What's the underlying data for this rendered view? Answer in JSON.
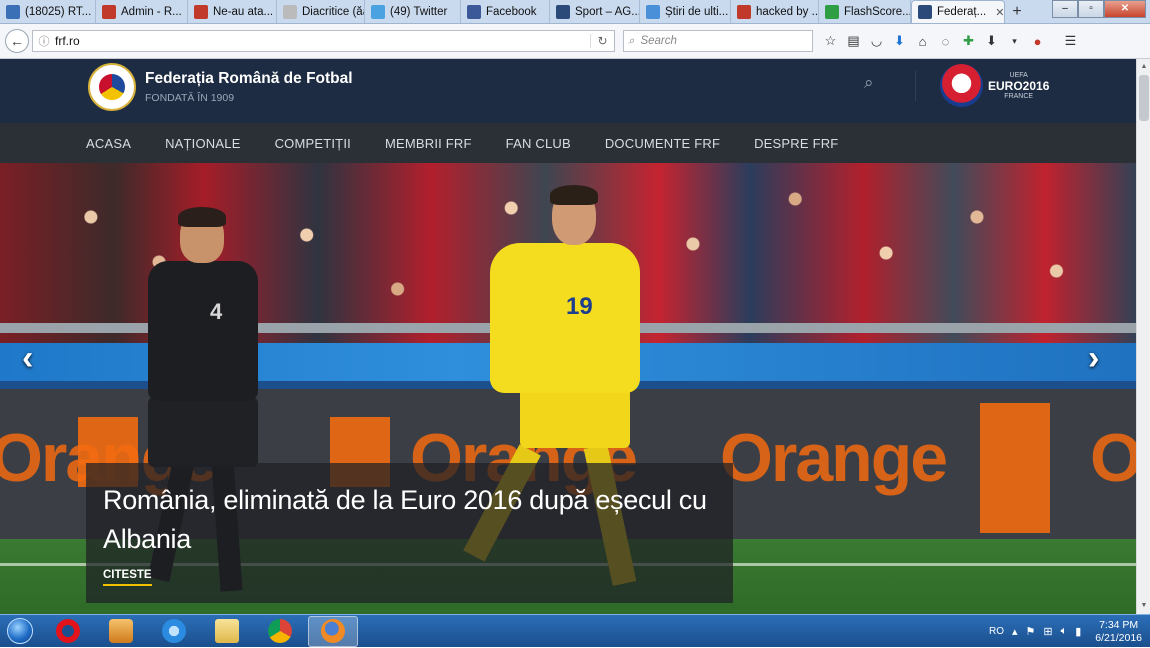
{
  "browser": {
    "tabs": [
      {
        "label": "(18025) RT...",
        "icon": "chat-icon",
        "color": "#3b6fb6"
      },
      {
        "label": "Admin - R...",
        "icon": "r-logo-icon",
        "color": "#c0392b"
      },
      {
        "label": "Ne-au ata...",
        "icon": "g-logo-icon",
        "color": "#c0392b"
      },
      {
        "label": "Diacritice (ăâîș...",
        "icon": "page-icon",
        "color": "#bbbbbb"
      },
      {
        "label": "(49) Twitter",
        "icon": "twitter-icon",
        "color": "#4aa3e0"
      },
      {
        "label": "Facebook",
        "icon": "facebook-icon",
        "color": "#3b5998"
      },
      {
        "label": "Sport – AG...",
        "icon": "sport-icon",
        "color": "#2b4a7a"
      },
      {
        "label": "Știri de ulti...",
        "icon": "globe-icon",
        "color": "#4a90d9"
      },
      {
        "label": "hacked by ...",
        "icon": "fire-icon",
        "color": "#c0392b"
      },
      {
        "label": "FlashScore...",
        "icon": "flashscore-icon",
        "color": "#2f9e44"
      },
      {
        "label": "Federaț...",
        "icon": "frf-icon",
        "color": "#2b4a7a"
      }
    ],
    "active_tab_index": 10,
    "new_tab": "+",
    "url": "frf.ro",
    "search_placeholder": "Search"
  },
  "site": {
    "title": "Federația Română de Fotbal",
    "subtitle": "FONDATĂ ÎN 1909",
    "euro": {
      "top": "UEFA",
      "main": "EURO2016",
      "bottom": "FRANCE"
    },
    "menu": [
      "ACASA",
      "NAȚIONALE",
      "COMPETIȚII",
      "MEMBRII FRF",
      "FAN CLUB",
      "DOCUMENTE FRF",
      "DESPRE FRF"
    ],
    "hero": {
      "headline": "România, eliminată de la Euro 2016 după eșecul cu Albania",
      "read_more": "CITESTE",
      "prev": "‹",
      "next": "›",
      "board_text": "Orange",
      "board_text_small": "orange",
      "player1_number": "4",
      "player2_number": "19"
    }
  },
  "taskbar": {
    "lang": "RO",
    "time": "7:34 PM",
    "date": "6/21/2016"
  },
  "colors": {
    "header_bg": "#1d2c42",
    "menu_bg": "#2b2f36",
    "accent": "#f2c200",
    "orange": "#f26a0f"
  }
}
